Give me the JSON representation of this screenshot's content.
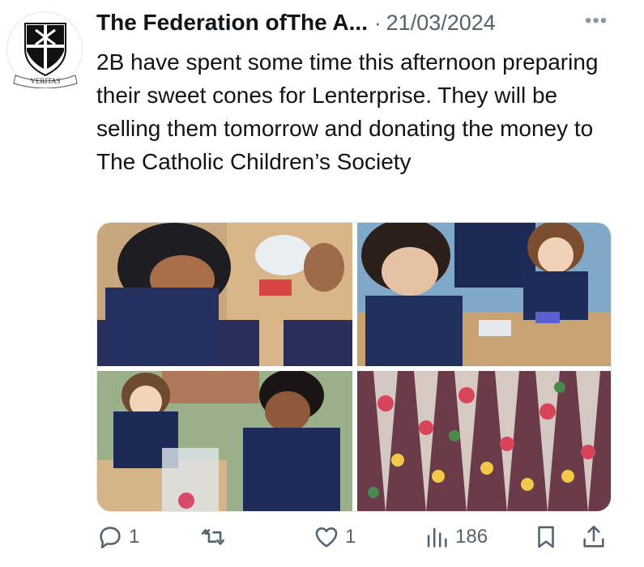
{
  "post": {
    "author_name": "The Federation ofThe A...",
    "separator": "·",
    "date": "21/03/2024",
    "more_label": "•••",
    "text": "2B have spent some time this afternoon preparing their sweet cones for Lenterprise. They will be selling them tomorrow and donating the money to The Catholic Children’s Society"
  },
  "avatar": {
    "motto": "VERITAS",
    "icon": "school-crest-icon"
  },
  "media": [
    {
      "id": "photo-1",
      "description_icon": "photo"
    },
    {
      "id": "photo-2",
      "description_icon": "photo"
    },
    {
      "id": "photo-3",
      "description_icon": "photo"
    },
    {
      "id": "photo-4",
      "description_icon": "photo"
    }
  ],
  "actions": {
    "reply_count": "1",
    "repost_count": "",
    "like_count": "1",
    "views_count": "186",
    "icons": [
      "reply-icon",
      "repost-icon",
      "like-icon",
      "views-icon",
      "bookmark-icon",
      "share-icon"
    ]
  },
  "colors": {
    "text": "#0f1419",
    "secondary": "#536471",
    "border": "#e1e8ed"
  }
}
